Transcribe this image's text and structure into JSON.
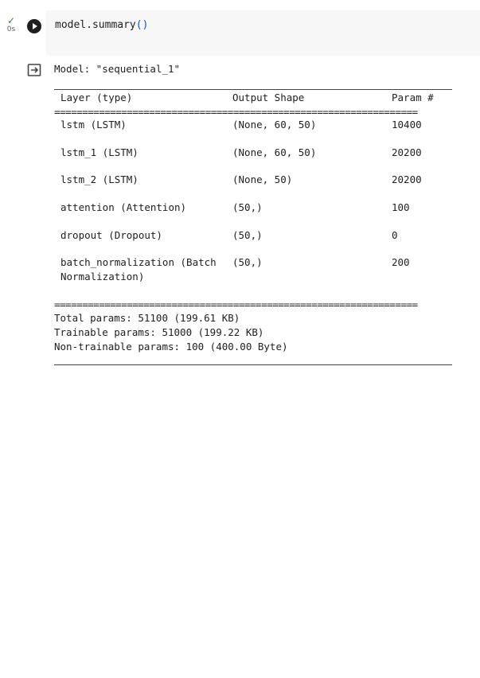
{
  "cell": {
    "exec_time": "0s",
    "code_object": "model",
    "code_method": ".summary",
    "code_parens": "()"
  },
  "output": {
    "model_title": "Model: \"sequential_1\"",
    "headers": {
      "layer": "Layer (type)",
      "shape": "Output Shape",
      "params": "Param #"
    },
    "double_rule": "=================================================================",
    "rows": [
      {
        "layer": "lstm (LSTM)",
        "shape": "(None, 60, 50)",
        "params": "10400"
      },
      {
        "layer": "lstm_1 (LSTM)",
        "shape": "(None, 60, 50)",
        "params": "20200"
      },
      {
        "layer": "lstm_2 (LSTM)",
        "shape": "(None, 50)",
        "params": "20200"
      },
      {
        "layer": "attention (Attention)",
        "shape": "(50,)",
        "params": "100"
      },
      {
        "layer": "dropout (Dropout)",
        "shape": "(50,)",
        "params": "0"
      },
      {
        "layer": "batch_normalization (Batch",
        "layer_cont": "Normalization)",
        "shape": "(50,)",
        "params": "200"
      }
    ],
    "total_params": "Total params: 51100 (199.61 KB)",
    "trainable_params": "Trainable params: 51000 (199.22 KB)",
    "non_trainable_params": "Non-trainable params: 100 (400.00 Byte)"
  },
  "colors": {
    "check": "#1e8e3e",
    "code_bg": "#f7f7f7",
    "paren": "#0b57d0"
  }
}
